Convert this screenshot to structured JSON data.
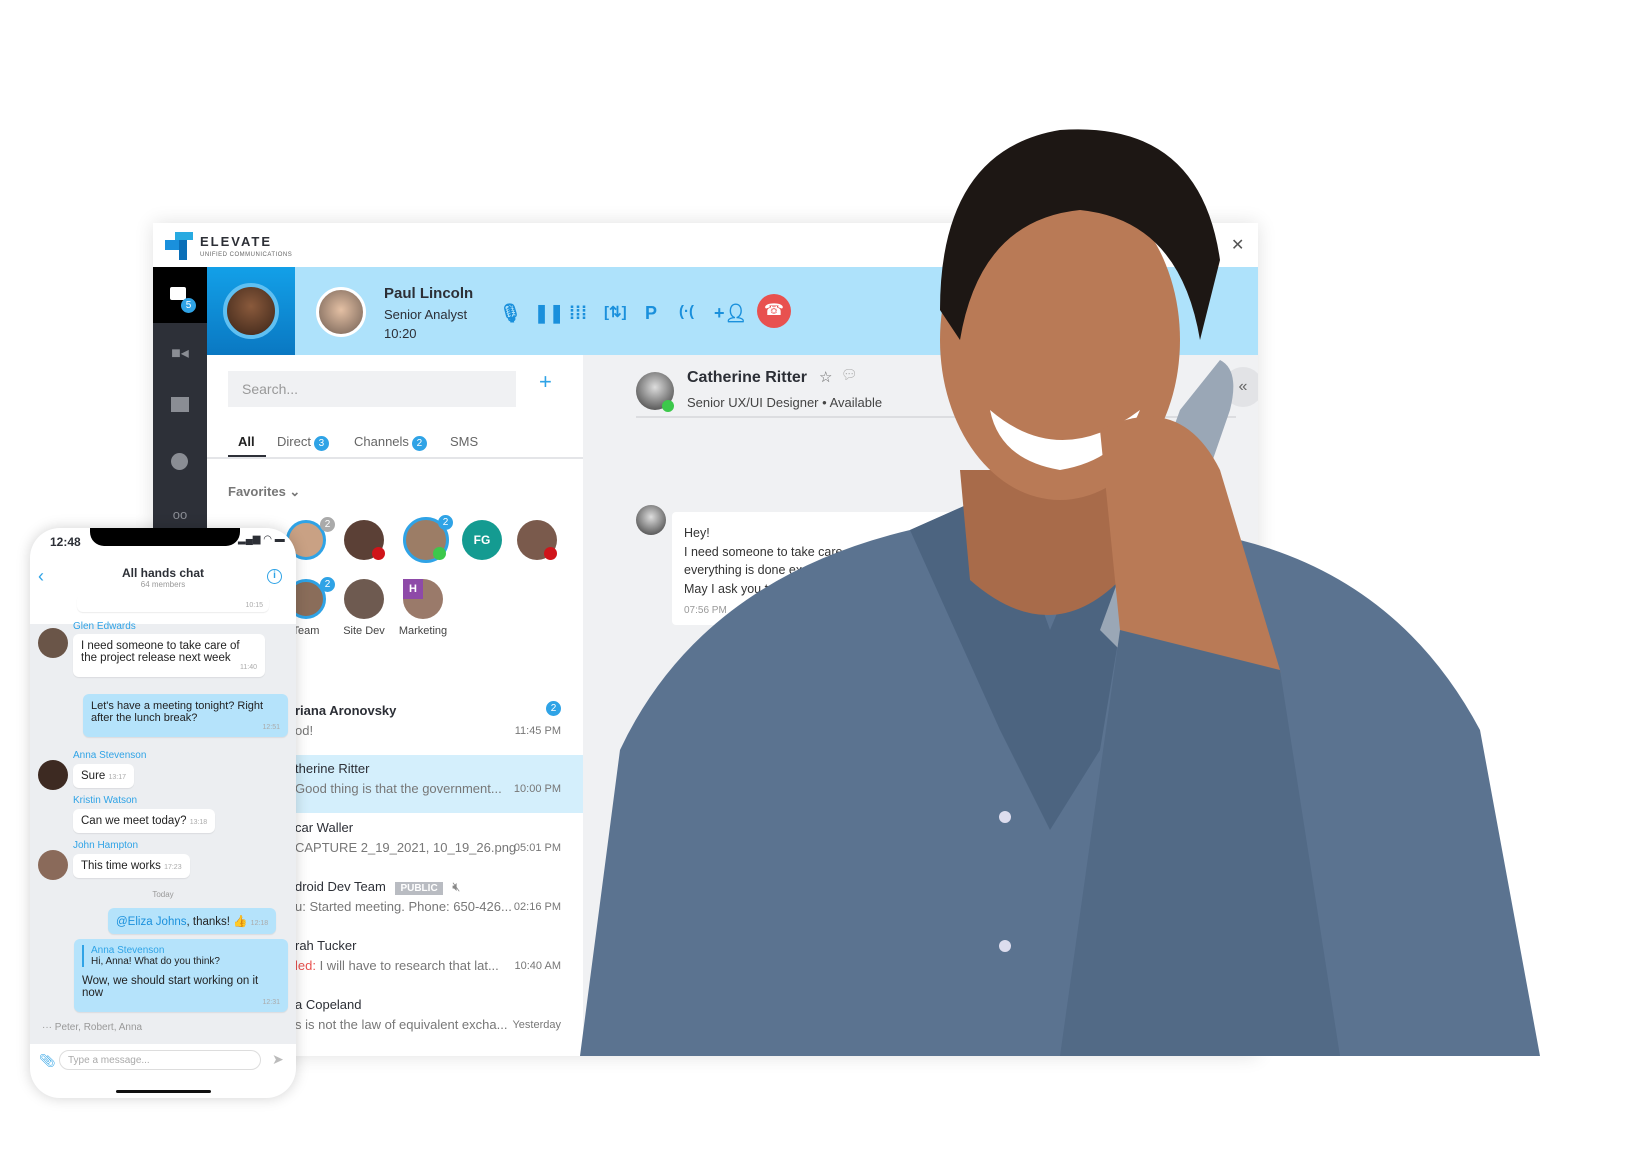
{
  "colors": {
    "accent": "#2fa3e6",
    "call_bar": "#aee2fb",
    "end_call": "#e8514f",
    "online": "#3cc84b",
    "busy": "#d0141a"
  },
  "app": {
    "brand": "ELEVATE",
    "brand_sub": "UNIFIED COMMUNICATIONS",
    "win_controls": [
      "□",
      "✕"
    ]
  },
  "sidebar": {
    "chat_badge": "5",
    "icons": [
      "chat-icon",
      "video-icon",
      "folder-icon",
      "clock-icon",
      "voicemail-icon"
    ]
  },
  "call": {
    "name": "Paul Lincoln",
    "title": "Senior Analyst",
    "duration": "10:20",
    "controls": [
      "microphone-icon",
      "pause-icon",
      "dialpad-icon",
      "transfer-icon",
      "park-icon",
      "merge-icon",
      "add-person-icon",
      "end-call-icon"
    ],
    "park_label": "P"
  },
  "contacts": {
    "search_placeholder": "Search...",
    "add": "+",
    "tabs": [
      {
        "label": "All"
      },
      {
        "label": "Direct",
        "badge": "3"
      },
      {
        "label": "Channels",
        "badge": "2"
      },
      {
        "label": "SMS"
      }
    ],
    "favorites_label": "Favorites",
    "favorites_initials": "FG",
    "fav_badges": [
      "2",
      "2",
      "2"
    ],
    "groups": [
      {
        "label": "Team"
      },
      {
        "label": "Site Dev"
      },
      {
        "label": "Marketing"
      }
    ],
    "group_initial": "H",
    "rows": [
      {
        "name": "riana Aronovsky",
        "preview": "od!",
        "time": "11:45 PM",
        "badge": "2"
      },
      {
        "name": "therine Ritter",
        "preview": "Good thing is that the government...",
        "time": "10:00 PM"
      },
      {
        "name": "car Waller",
        "preview": "CAPTURE 2_19_2021, 10_19_26.png",
        "time": "05:01 PM"
      },
      {
        "name": "droid Dev Team",
        "tag": "PUBLIC",
        "preview": "u: Started meeting. Phone: 650-426...",
        "time": "02:16 PM"
      },
      {
        "name": "rah Tucker",
        "prefix": "led:",
        "preview": " I will have to research that lat...",
        "time": "10:40 AM"
      },
      {
        "name": "a Copeland",
        "preview": "s is not the law of equivalent excha...",
        "time": "Yesterday"
      }
    ]
  },
  "chat": {
    "name": "Catherine Ritter",
    "title": "Senior UX/UI Designer",
    "status": "Available",
    "sep": "•",
    "message": {
      "lines": [
        "Hey!",
        "I need someone to take care of the project",
        "everything is done except the promo m",
        "May I ask you to do this?"
      ],
      "time": "07:56 PM"
    }
  },
  "phone": {
    "time": "12:48",
    "chat_title": "All hands chat",
    "members": "64 members",
    "messages": [
      {
        "time": "10:15"
      },
      {
        "sender": "Glen Edwards",
        "text": "I need someone to take care of the project release next week",
        "time": "11:40"
      },
      {
        "text": "Let's have a meeting tonight? Right after the lunch break?",
        "time": "12:51"
      },
      {
        "sender": "Anna Stevenson",
        "text": "Sure",
        "time": "13:17"
      },
      {
        "sender": "Kristin Watson",
        "text": "Can we meet today?",
        "time": "13:18"
      },
      {
        "sender": "John Hampton",
        "text": "This time works",
        "time": "17:23"
      },
      {
        "mention": "@Eliza Johns",
        "text": ", thanks! 👍",
        "time": "12:18"
      },
      {
        "quote_sender": "Anna Stevenson",
        "quote": "Hi, Anna! What do you think?",
        "text": "Wow, we should start working on it now",
        "time": "12:31"
      }
    ],
    "day": "Today",
    "typing": "Peter, Robert, Anna",
    "input_placeholder": "Type a message..."
  }
}
